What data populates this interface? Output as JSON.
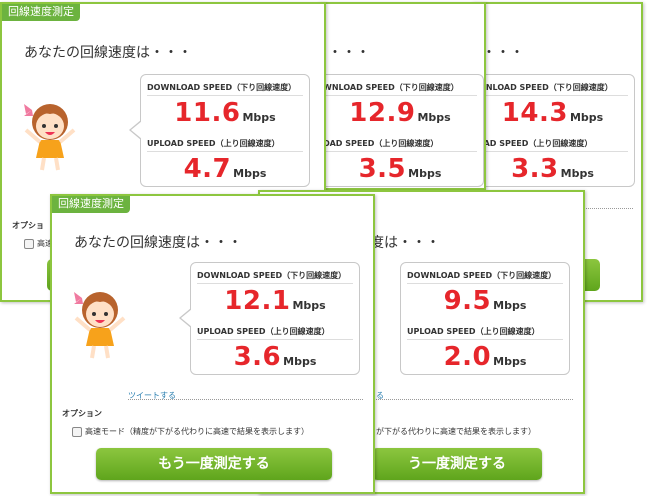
{
  "tag_label": "回線速度測定",
  "heading": "あなたの回線速度は・・・",
  "heading_partial": "・・・",
  "heading_partial2": "度は・・・",
  "download_label": "DOWNLOAD SPEED（下り回線速度）",
  "download_label_partial": "WNLOAD SPEED（下り回線速度）",
  "upload_label": "UPLOAD SPEED（上り回線速度）",
  "upload_label_partial": "OAD SPEED（上り回線速度）",
  "unit": "Mbps",
  "cards": [
    {
      "download": "11.6",
      "upload": "4.7"
    },
    {
      "download": "12.9",
      "upload": "3.5"
    },
    {
      "download": "14.3",
      "upload": "3.3"
    },
    {
      "download": "12.1",
      "upload": "3.6"
    },
    {
      "download": "9.5",
      "upload": "2.0"
    }
  ],
  "tweet_label": "ツイートする",
  "tweet_partial": "る",
  "options_title": "オプション",
  "options_title_partial": "オプショ",
  "fast_mode_label": "高速モード（精度が下がる代わりに高速で結果を表示します）",
  "fast_mode_partial": "が下がる代わりに高速で結果を表示します）",
  "fast_mode_stub": "高速",
  "retest_label": "もう一度測定する",
  "retest_partial": "う一度測定する",
  "colors": {
    "accent": "#8dc63f",
    "speed": "#e6262b",
    "link": "#2a7fb0"
  }
}
